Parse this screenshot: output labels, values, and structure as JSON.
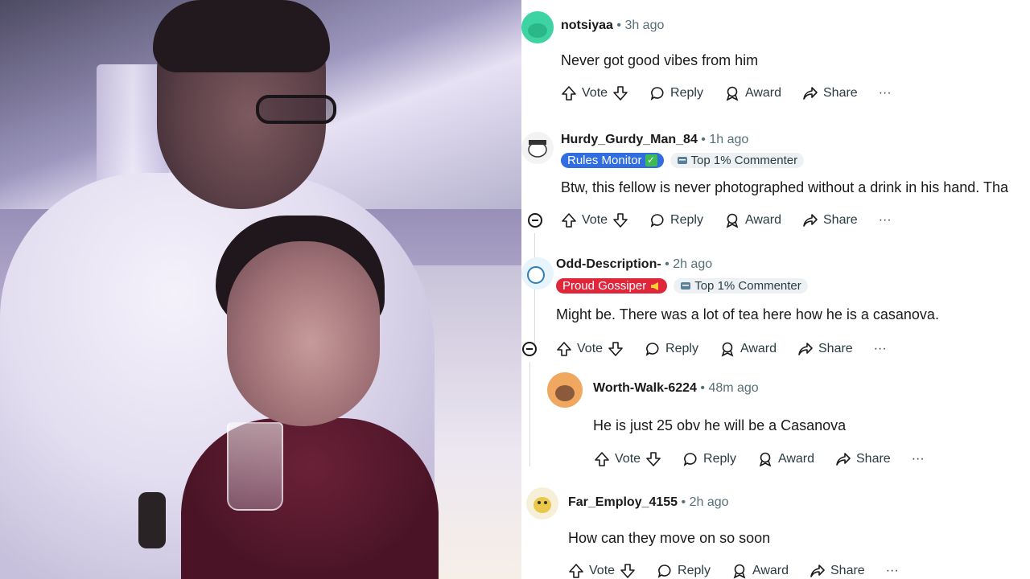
{
  "comments": [
    {
      "author": "notsiyaa",
      "time": "3h ago",
      "text": "Never got good vibes from him",
      "avatar_color": "#3ed3a3"
    },
    {
      "author": "Hurdy_Gurdy_Man_84",
      "time": "1h ago",
      "flair_primary": "Rules Monitor",
      "flair_secondary": "Top 1% Commenter",
      "text": "Btw, this fellow is never photographed without a drink in his hand. Tha"
    },
    {
      "author": "Odd-Description-",
      "time": "2h ago",
      "flair_primary": "Proud Gossiper",
      "flair_secondary": "Top 1% Commenter",
      "text": "Might be. There was a lot of tea here how he is a casanova."
    },
    {
      "author": "Worth-Walk-6224",
      "time": "48m ago",
      "text": "He is just 25 obv he will be a Casanova"
    },
    {
      "author": "Far_Employ_4155",
      "time": "2h ago",
      "text": "How can they move on so soon"
    }
  ],
  "actions": {
    "vote": "Vote",
    "reply": "Reply",
    "award": "Award",
    "share": "Share",
    "more": "···"
  },
  "separator": "•",
  "colors": {
    "flair_blue": "#2f6de0",
    "flair_red": "#e0263a",
    "text": "#1a1a1b",
    "meta": "#576f76"
  }
}
